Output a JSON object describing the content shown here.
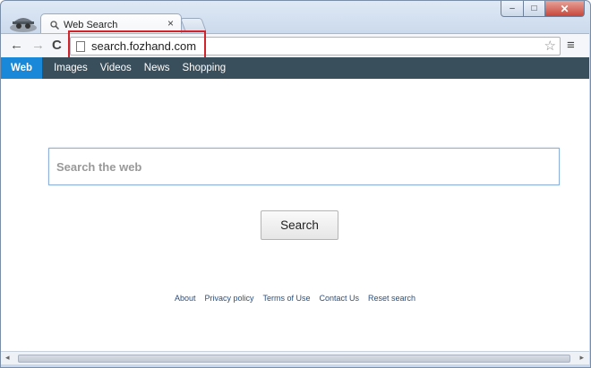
{
  "browser": {
    "tab_title": "Web Search",
    "tab_close": "×",
    "url": "search.fozhand.com",
    "window_controls": {
      "minimize": "–",
      "maximize": "□",
      "close": "✕"
    }
  },
  "toolbar": {
    "back": "←",
    "forward": "→",
    "reload": "C",
    "star": "☆",
    "menu": "≡"
  },
  "navbar": {
    "items": [
      {
        "label": "Web",
        "active": true
      },
      {
        "label": "Images"
      },
      {
        "label": "Videos"
      },
      {
        "label": "News"
      },
      {
        "label": "Shopping"
      }
    ]
  },
  "search": {
    "placeholder": "Search the web",
    "button_label": "Search"
  },
  "footer": {
    "links": [
      "About",
      "Privacy policy",
      "Terms of Use",
      "Contact Us",
      "Reset search"
    ]
  },
  "colors": {
    "navbar_bg": "#3a4f5c",
    "active_tab": "#1a88d8",
    "highlight_box": "#d2232a"
  }
}
